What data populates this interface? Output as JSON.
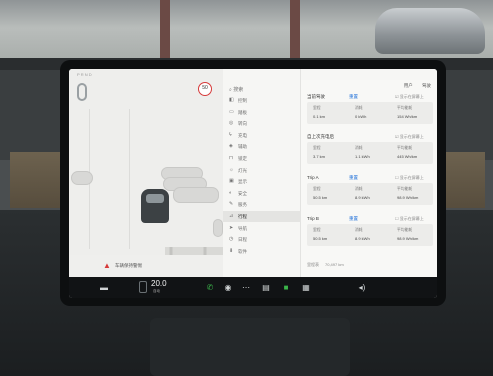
{
  "status_bar": {
    "left_text": "P R N D",
    "pill_label": "LTE"
  },
  "speed_limit": "50",
  "alert": {
    "icon": "warning-triangle-icon",
    "text": "车辆保持警惕"
  },
  "settings": {
    "search_label": "搜索",
    "nav_items": [
      {
        "icon": "control-icon",
        "label": "控制"
      },
      {
        "icon": "pedals-icon",
        "label": "踏板"
      },
      {
        "icon": "steering-icon",
        "label": "转向"
      },
      {
        "icon": "charge-icon",
        "label": "充电"
      },
      {
        "icon": "autopilot-icon",
        "label": "辅助"
      },
      {
        "icon": "locks-icon",
        "label": "锁定"
      },
      {
        "icon": "lights-icon",
        "label": "灯光"
      },
      {
        "icon": "display-icon",
        "label": "显示"
      },
      {
        "icon": "safety-icon",
        "label": "安全"
      },
      {
        "icon": "service-icon",
        "label": "服务"
      },
      {
        "icon": "trips-icon",
        "label": "行程"
      },
      {
        "icon": "navigation-icon",
        "label": "导航"
      },
      {
        "icon": "schedule-icon",
        "label": "日程"
      },
      {
        "icon": "software-icon",
        "label": "软件"
      }
    ],
    "active_index": 10,
    "header_items": [
      "用户",
      "驾驶"
    ],
    "trips": [
      {
        "title": "当前驾驶",
        "reset_label": "重置",
        "checkbox_label": "显示在屏幕上",
        "stats": [
          {
            "label": "里程",
            "value": "0.1 km"
          },
          {
            "label": "消耗",
            "value": "0 kWh"
          },
          {
            "label": "平均能耗",
            "value": "154 Wh/km"
          }
        ]
      },
      {
        "title": "自上次充电后",
        "reset_label": "",
        "checkbox_label": "显示在屏幕上",
        "stats": [
          {
            "label": "里程",
            "value": "3.7 km"
          },
          {
            "label": "消耗",
            "value": "1.1 kWh"
          },
          {
            "label": "平均能耗",
            "value": "445 Wh/km"
          }
        ]
      },
      {
        "title": "Trip A",
        "reset_label": "重置",
        "checkbox_label": "显示在屏幕上",
        "stats": [
          {
            "label": "里程",
            "value": "50.5 km"
          },
          {
            "label": "消耗",
            "value": "8.9 kWh"
          },
          {
            "label": "平均能耗",
            "value": "98.9 Wh/km"
          }
        ]
      },
      {
        "title": "Trip B",
        "reset_label": "重置",
        "checkbox_label": "显示在屏幕上",
        "stats": [
          {
            "label": "里程",
            "value": "50.5 km"
          },
          {
            "label": "消耗",
            "value": "8.9 kWh"
          },
          {
            "label": "平均能耗",
            "value": "98.9 Wh/km"
          }
        ]
      }
    ],
    "odometer_label": "里程表",
    "odometer_value": "70,497 km"
  },
  "dock": {
    "temperature": "20.0",
    "temp_sub": "自动",
    "items": [
      {
        "icon": "car-icon"
      },
      {
        "icon": "phone-icon"
      },
      {
        "icon": "camera-icon"
      },
      {
        "icon": "dots-icon"
      },
      {
        "icon": "media-icon"
      },
      {
        "icon": "app-icon"
      },
      {
        "icon": "calendar-icon"
      },
      {
        "icon": "volume-icon"
      }
    ]
  },
  "colors": {
    "accent_blue": "#1f6fd9",
    "accent_green": "#3bb54a",
    "alert_red": "#d63a3a"
  }
}
